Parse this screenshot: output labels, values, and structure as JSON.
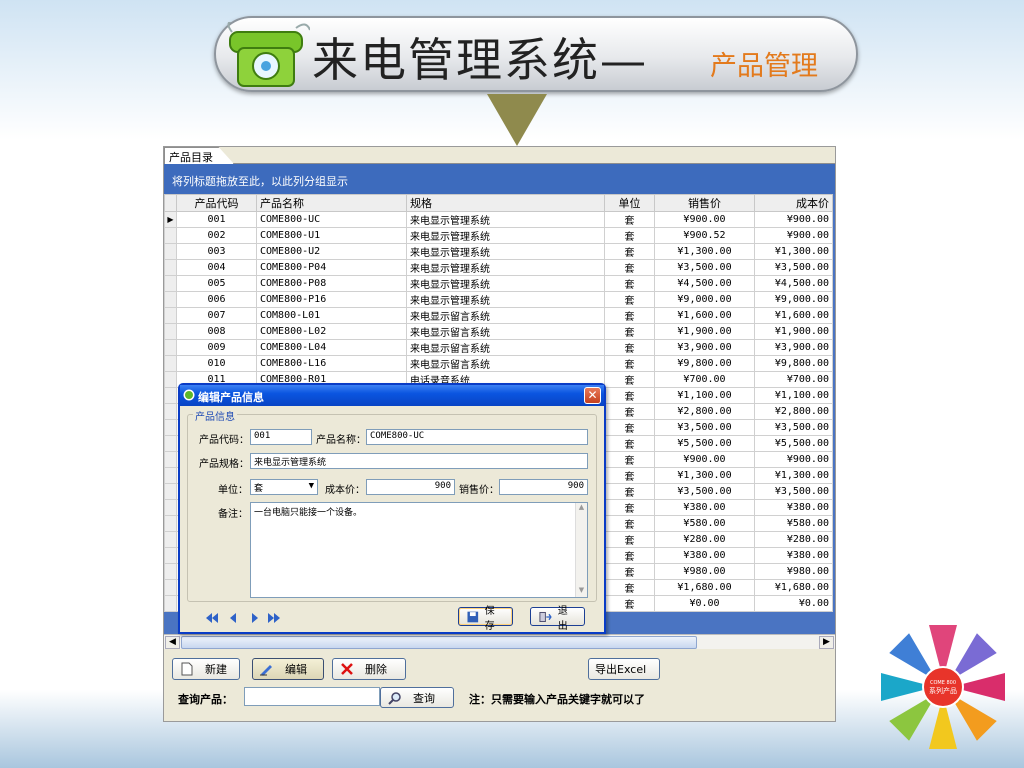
{
  "banner": {
    "title": "来电管理系统—",
    "subtitle": "产品管理"
  },
  "main_window": {
    "tab_label": "产品目录",
    "group_hint": "将列标题拖放至此，以此列分组显示",
    "columns": [
      "产品代码",
      "产品名称",
      "规格",
      "单位",
      "销售价",
      "成本价"
    ],
    "rows": [
      {
        "code": "001",
        "name": "COME800-UC",
        "spec": "来电显示管理系统",
        "unit": "套",
        "sale": "¥900.00",
        "cost": "¥900.00"
      },
      {
        "code": "002",
        "name": "COME800-U1",
        "spec": "来电显示管理系统",
        "unit": "套",
        "sale": "¥900.52",
        "cost": "¥900.00"
      },
      {
        "code": "003",
        "name": "COME800-U2",
        "spec": "来电显示管理系统",
        "unit": "套",
        "sale": "¥1,300.00",
        "cost": "¥1,300.00"
      },
      {
        "code": "004",
        "name": "COME800-P04",
        "spec": "来电显示管理系统",
        "unit": "套",
        "sale": "¥3,500.00",
        "cost": "¥3,500.00"
      },
      {
        "code": "005",
        "name": "COME800-P08",
        "spec": "来电显示管理系统",
        "unit": "套",
        "sale": "¥4,500.00",
        "cost": "¥4,500.00"
      },
      {
        "code": "006",
        "name": "COME800-P16",
        "spec": "来电显示管理系统",
        "unit": "套",
        "sale": "¥9,000.00",
        "cost": "¥9,000.00"
      },
      {
        "code": "007",
        "name": "COM800-L01",
        "spec": "来电显示留言系统",
        "unit": "套",
        "sale": "¥1,600.00",
        "cost": "¥1,600.00"
      },
      {
        "code": "008",
        "name": "COME800-L02",
        "spec": "来电显示留言系统",
        "unit": "套",
        "sale": "¥1,900.00",
        "cost": "¥1,900.00"
      },
      {
        "code": "009",
        "name": "COME800-L04",
        "spec": "来电显示留言系统",
        "unit": "套",
        "sale": "¥3,900.00",
        "cost": "¥3,900.00"
      },
      {
        "code": "010",
        "name": "COME800-L16",
        "spec": "来电显示留言系统",
        "unit": "套",
        "sale": "¥9,800.00",
        "cost": "¥9,800.00"
      },
      {
        "code": "011",
        "name": "COME800-R01",
        "spec": "电话录音系统",
        "unit": "套",
        "sale": "¥700.00",
        "cost": "¥700.00"
      },
      {
        "code": "",
        "name": "",
        "spec": "",
        "unit": "套",
        "sale": "¥1,100.00",
        "cost": "¥1,100.00"
      },
      {
        "code": "",
        "name": "",
        "spec": "",
        "unit": "套",
        "sale": "¥2,800.00",
        "cost": "¥2,800.00"
      },
      {
        "code": "",
        "name": "",
        "spec": "",
        "unit": "套",
        "sale": "¥3,500.00",
        "cost": "¥3,500.00"
      },
      {
        "code": "",
        "name": "",
        "spec": "",
        "unit": "套",
        "sale": "¥5,500.00",
        "cost": "¥5,500.00"
      },
      {
        "code": "",
        "name": "",
        "spec": "",
        "unit": "套",
        "sale": "¥900.00",
        "cost": "¥900.00"
      },
      {
        "code": "",
        "name": "",
        "spec": "",
        "unit": "套",
        "sale": "¥1,300.00",
        "cost": "¥1,300.00"
      },
      {
        "code": "",
        "name": "",
        "spec": "",
        "unit": "套",
        "sale": "¥3,500.00",
        "cost": "¥3,500.00"
      },
      {
        "code": "",
        "name": "",
        "spec": "",
        "unit": "套",
        "sale": "¥380.00",
        "cost": "¥380.00"
      },
      {
        "code": "",
        "name": "",
        "spec": "",
        "unit": "套",
        "sale": "¥580.00",
        "cost": "¥580.00"
      },
      {
        "code": "",
        "name": "",
        "spec": "",
        "unit": "套",
        "sale": "¥280.00",
        "cost": "¥280.00"
      },
      {
        "code": "",
        "name": "",
        "spec": "",
        "unit": "套",
        "sale": "¥380.00",
        "cost": "¥380.00"
      },
      {
        "code": "",
        "name": "",
        "spec": "",
        "unit": "套",
        "sale": "¥980.00",
        "cost": "¥980.00"
      },
      {
        "code": "",
        "name": "",
        "spec": "",
        "unit": "套",
        "sale": "¥1,680.00",
        "cost": "¥1,680.00"
      },
      {
        "code": "",
        "name": "",
        "spec": "",
        "unit": "套",
        "sale": "¥0.00",
        "cost": "¥0.00"
      }
    ],
    "buttons": {
      "new_label": "新建",
      "edit_label": "编辑",
      "delete_label": "删除",
      "export_label": "导出Excel",
      "query_label": "查询"
    },
    "query_field_label": "查询产品：",
    "query_value": "",
    "hint": "注：只需要输入产品关键字就可以了"
  },
  "dialog": {
    "title": "编辑产品信息",
    "group_title": "产品信息",
    "code_label": "产品代码：",
    "code_value": "001",
    "name_label": "产品名称：",
    "name_value": "COME800-UC",
    "spec_label": "产品规格：",
    "spec_value": "来电显示管理系统",
    "unit_label": "单位：",
    "unit_value": "套",
    "cost_label": "成本价：",
    "cost_value": "900",
    "sale_label": "销售价：",
    "sale_value": "900",
    "remark_label": "备注：",
    "remark_value": "一台电脑只能接一个设备。",
    "save_label": "保存",
    "exit_label": "退出"
  },
  "logo": {
    "brand": "COME 800",
    "caption": "系列产品"
  },
  "colors": {
    "group_bar": "#3d6bbd",
    "title_bar": "#0b55e0",
    "accent_orange": "#e37a1c",
    "arrow": "#8f8a4d"
  }
}
